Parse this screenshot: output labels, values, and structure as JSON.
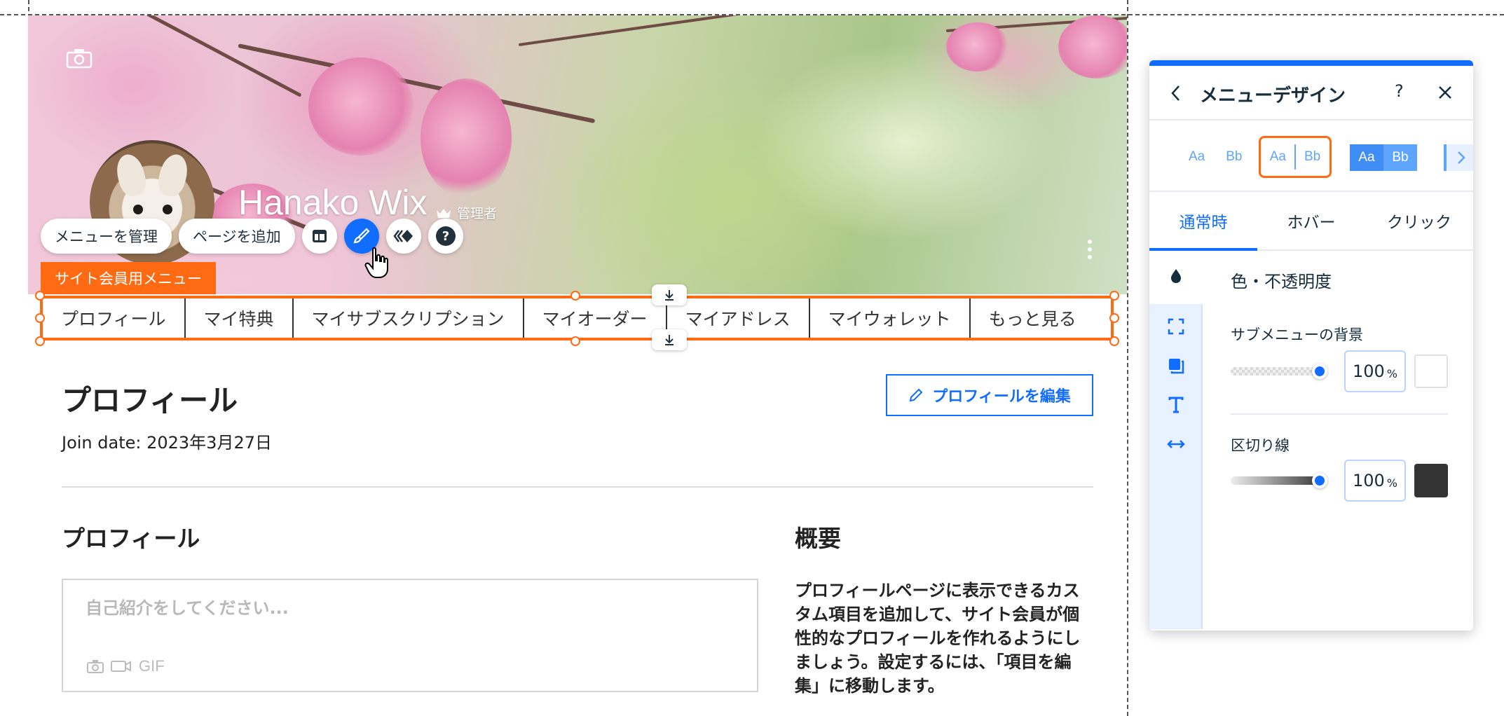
{
  "cover": {
    "member_name": "Hanako Wix",
    "admin_badge": "管理者"
  },
  "action_bar": {
    "manage_menu": "メニューを管理",
    "add_page": "ページを追加",
    "icons": [
      "layout-icon",
      "brush-icon",
      "animation-icon",
      "help-icon"
    ],
    "active_icon": "brush-icon"
  },
  "menu": {
    "tag": "サイト会員用メニュー",
    "items": [
      "プロフィール",
      "マイ特典",
      "マイサブスクリプション",
      "マイオーダー",
      "マイアドレス",
      "マイウォレット",
      "もっと見る"
    ]
  },
  "profile": {
    "page_title": "プロフィール",
    "join_date": "Join date: 2023年3月27日",
    "edit_button": "プロフィールを編集",
    "section_title": "プロフィール",
    "bio_placeholder": "自己紹介をしてください...",
    "gif_label": "GIF",
    "overview_title": "概要",
    "overview_text": "プロフィールページに表示できるカスタム項目を追加して、サイト会員が個性的なプロフィールを作れるようにしましょう。設定するには、「項目を編集」に移動します。"
  },
  "panel": {
    "title": "メニューデザイン",
    "help": "?",
    "presets": [
      {
        "a": "Aa",
        "b": "Bb"
      },
      {
        "a": "Aa",
        "b": "Bb"
      },
      {
        "a": "Aa",
        "b": "Bb"
      }
    ],
    "tabs": [
      "通常時",
      "ホバー",
      "クリック"
    ],
    "active_tab": "通常時",
    "section_title": "色・不透明度",
    "submenu_bg_label": "サブメニューの背景",
    "submenu_bg_value": "100",
    "submenu_bg_color": "#ffffff",
    "divider_label": "区切り線",
    "divider_value": "100",
    "divider_color": "#333333",
    "percent": "%"
  },
  "colors": {
    "accent": "#116dff",
    "selection": "#ff6a13"
  }
}
